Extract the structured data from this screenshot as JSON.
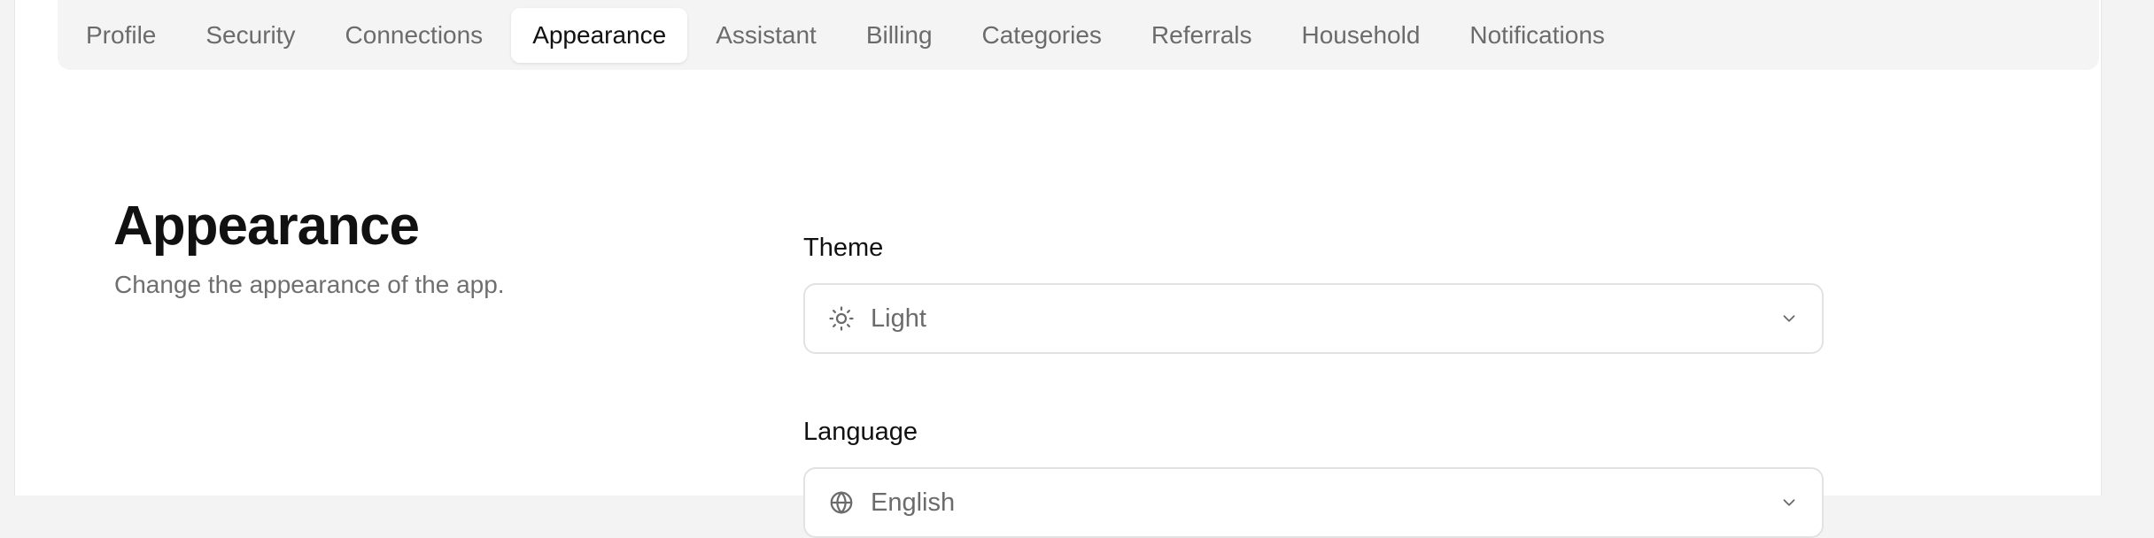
{
  "tabs": [
    {
      "label": "Profile",
      "active": false
    },
    {
      "label": "Security",
      "active": false
    },
    {
      "label": "Connections",
      "active": false
    },
    {
      "label": "Appearance",
      "active": true
    },
    {
      "label": "Assistant",
      "active": false
    },
    {
      "label": "Billing",
      "active": false
    },
    {
      "label": "Categories",
      "active": false
    },
    {
      "label": "Referrals",
      "active": false
    },
    {
      "label": "Household",
      "active": false
    },
    {
      "label": "Notifications",
      "active": false
    }
  ],
  "section": {
    "title": "Appearance",
    "subtitle": "Change the appearance of the app."
  },
  "theme": {
    "label": "Theme",
    "value": "Light",
    "icon": "sun-icon"
  },
  "language": {
    "label": "Language",
    "value": "English",
    "icon": "globe-icon"
  },
  "colors": {
    "background": "#f3f3f3",
    "panel": "#ffffff",
    "tabbar": "#f4f4f4",
    "muted_text": "#6b6b6b",
    "border": "#e2e2e2"
  }
}
